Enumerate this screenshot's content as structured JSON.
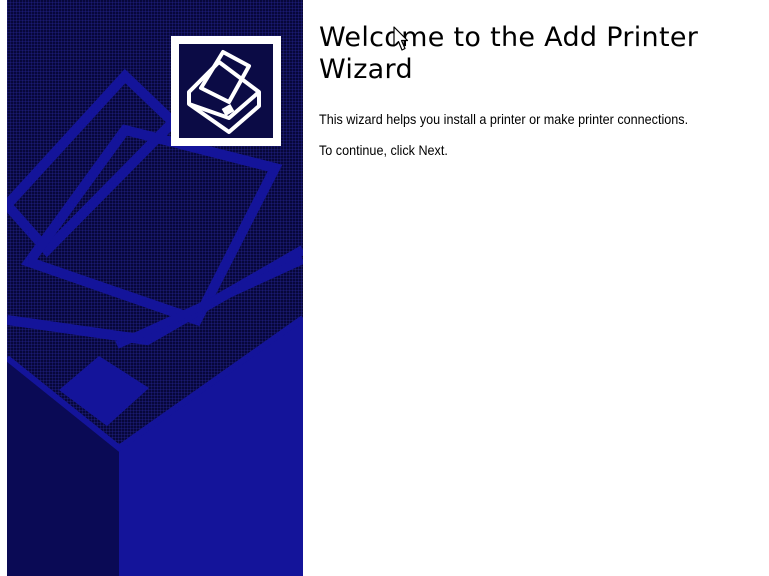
{
  "wizard": {
    "title": "Welcome to the Add Printer Wizard",
    "description": "This wizard helps you install a printer or make printer connections.",
    "instruction": "To continue, click Next."
  },
  "banner": {
    "background_color": "#07073a",
    "art_color": "#14149a",
    "logo_icon": "printer-icon"
  },
  "cursor": {
    "icon": "arrow-pointer-icon"
  }
}
